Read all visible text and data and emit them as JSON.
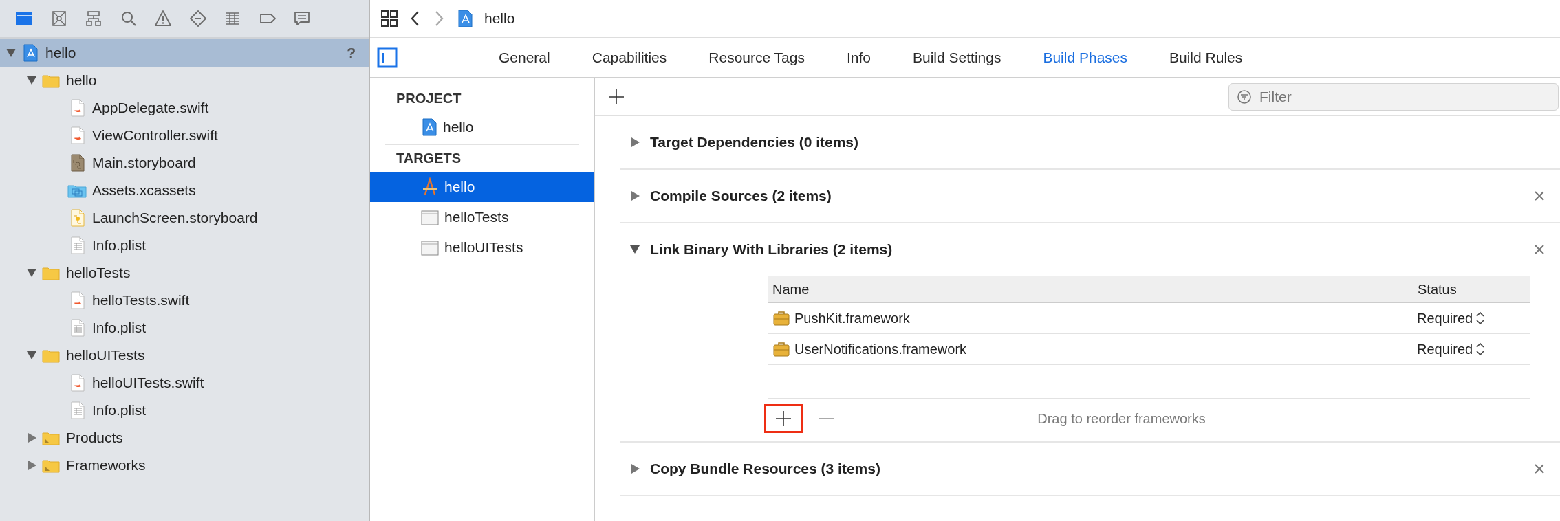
{
  "navigator_tabs": [
    {
      "kind": "folder",
      "selected": true
    },
    {
      "kind": "source-control",
      "selected": false
    },
    {
      "kind": "hierarchy",
      "selected": false
    },
    {
      "kind": "search",
      "selected": false
    },
    {
      "kind": "warning",
      "selected": false
    },
    {
      "kind": "test",
      "selected": false
    },
    {
      "kind": "debug",
      "selected": false
    },
    {
      "kind": "breakpoint",
      "selected": false
    },
    {
      "kind": "report",
      "selected": false
    }
  ],
  "tree": [
    {
      "label": "hello",
      "kind": "project",
      "badge": "?",
      "selected": true,
      "expanded": true,
      "children": [
        {
          "label": "hello",
          "kind": "folder",
          "selected": false,
          "expanded": true,
          "children": [
            {
              "label": "AppDelegate.swift",
              "kind": "swift",
              "selected": false
            },
            {
              "label": "ViewController.swift",
              "kind": "swift",
              "selected": false
            },
            {
              "label": "Main.storyboard",
              "kind": "storyboard",
              "selected": false
            },
            {
              "label": "Assets.xcassets",
              "kind": "assets",
              "selected": false
            },
            {
              "label": "LaunchScreen.storyboard",
              "kind": "launch",
              "selected": false
            },
            {
              "label": "Info.plist",
              "kind": "plist",
              "selected": false
            }
          ]
        },
        {
          "label": "helloTests",
          "kind": "folder",
          "selected": false,
          "expanded": true,
          "children": [
            {
              "label": "helloTests.swift",
              "kind": "swift",
              "selected": false
            },
            {
              "label": "Info.plist",
              "kind": "plist",
              "selected": false
            }
          ]
        },
        {
          "label": "helloUITests",
          "kind": "folder",
          "selected": false,
          "expanded": true,
          "children": [
            {
              "label": "helloUITests.swift",
              "kind": "swift",
              "selected": false
            },
            {
              "label": "Info.plist",
              "kind": "plist",
              "selected": false
            }
          ]
        },
        {
          "label": "Products",
          "kind": "group",
          "selected": false,
          "expanded": false
        },
        {
          "label": "Frameworks",
          "kind": "group",
          "selected": false,
          "expanded": false
        }
      ]
    }
  ],
  "jump_bar": {
    "crumb": "hello"
  },
  "tabs": [
    {
      "label": "General",
      "selected": false
    },
    {
      "label": "Capabilities",
      "selected": false
    },
    {
      "label": "Resource Tags",
      "selected": false
    },
    {
      "label": "Info",
      "selected": false
    },
    {
      "label": "Build Settings",
      "selected": false
    },
    {
      "label": "Build Phases",
      "selected": true
    },
    {
      "label": "Build Rules",
      "selected": false
    }
  ],
  "targets_panel": {
    "project_heading": "PROJECT",
    "projects": [
      {
        "label": "hello",
        "selected": false
      }
    ],
    "targets_heading": "TARGETS",
    "targets": [
      {
        "label": "hello",
        "kind": "app",
        "selected": true
      },
      {
        "label": "helloTests",
        "kind": "bundle",
        "selected": false
      },
      {
        "label": "helloUITests",
        "kind": "bundle",
        "selected": false
      }
    ]
  },
  "filter": {
    "placeholder": "Filter"
  },
  "phases": [
    {
      "title": "Target Dependencies (0 items)",
      "expanded": false,
      "removable": false
    },
    {
      "title": "Compile Sources (2 items)",
      "expanded": false,
      "removable": true
    },
    {
      "title": "Link Binary With Libraries (2 items)",
      "expanded": true,
      "removable": true,
      "table": {
        "columns": [
          "Name",
          "Status"
        ],
        "rows": [
          {
            "name": "PushKit.framework",
            "status": "Required"
          },
          {
            "name": "UserNotifications.framework",
            "status": "Required"
          }
        ],
        "hint": "Drag to reorder frameworks",
        "add_highlighted": true
      }
    },
    {
      "title": "Copy Bundle Resources (3 items)",
      "expanded": false,
      "removable": true
    }
  ]
}
